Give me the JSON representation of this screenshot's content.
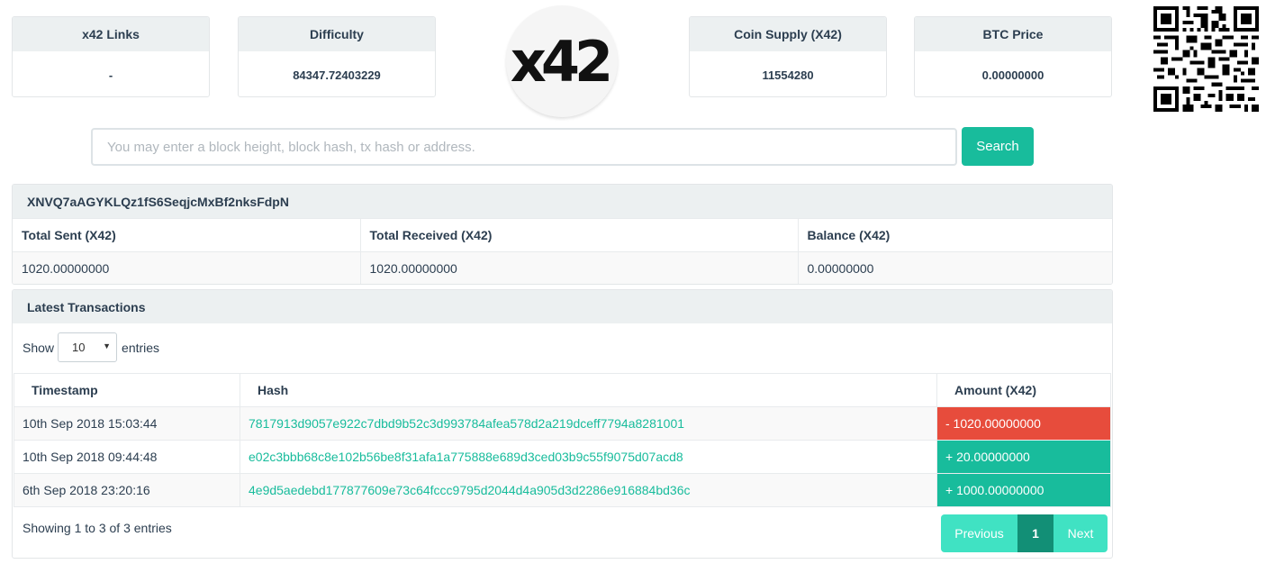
{
  "stats": {
    "links": {
      "label": "x42 Links",
      "value": "-"
    },
    "difficulty": {
      "label": "Difficulty",
      "value": "84347.72403229"
    },
    "supply": {
      "label": "Coin Supply (X42)",
      "value": "11554280"
    },
    "btc": {
      "label": "BTC Price",
      "value": "0.00000000"
    }
  },
  "logo": {
    "text": "x42"
  },
  "search": {
    "placeholder": "You may enter a block height, block hash, tx hash or address.",
    "value": "",
    "button": "Search"
  },
  "address": {
    "id": "XNVQ7aAGYKLQz1fS6SeqjcMxBf2nksFdpN",
    "headers": [
      "Total Sent (X42)",
      "Total Received (X42)",
      "Balance (X42)"
    ],
    "values": [
      "1020.00000000",
      "1020.00000000",
      "0.00000000"
    ]
  },
  "transactions": {
    "title": "Latest Transactions",
    "show_label": "Show",
    "entries_label": "entries",
    "page_length": "10",
    "headers": [
      "Timestamp",
      "Hash",
      "Amount (X42)"
    ],
    "rows": [
      {
        "timestamp": "10th Sep 2018 15:03:44",
        "hash": "7817913d9057e922c7dbd9b52c3d993784afea578d2a219dceff7794a8281001",
        "amount": "- 1020.00000000"
      },
      {
        "timestamp": "10th Sep 2018 09:44:48",
        "hash": "e02c3bbb68c8e102b56be8f31afa1a775888e689d3ced03b9c55f9075d07acd8",
        "amount": "+ 20.00000000"
      },
      {
        "timestamp": "6th Sep 2018 23:20:16",
        "hash": "4e9d5aedebd177877609e73c64fccc9795d2044d4a905d3d2286e916884bd36c",
        "amount": "+ 1000.00000000"
      }
    ],
    "info": "Showing 1 to 3 of 3 entries",
    "pagination": {
      "previous": "Previous",
      "current": "1",
      "next": "Next"
    }
  },
  "colors": {
    "accent": "#18bc9c",
    "negative": "#e74c3c",
    "header_bg": "#ecf0f1",
    "pager_light": "#40e2c3",
    "pager_active": "#128f76"
  }
}
